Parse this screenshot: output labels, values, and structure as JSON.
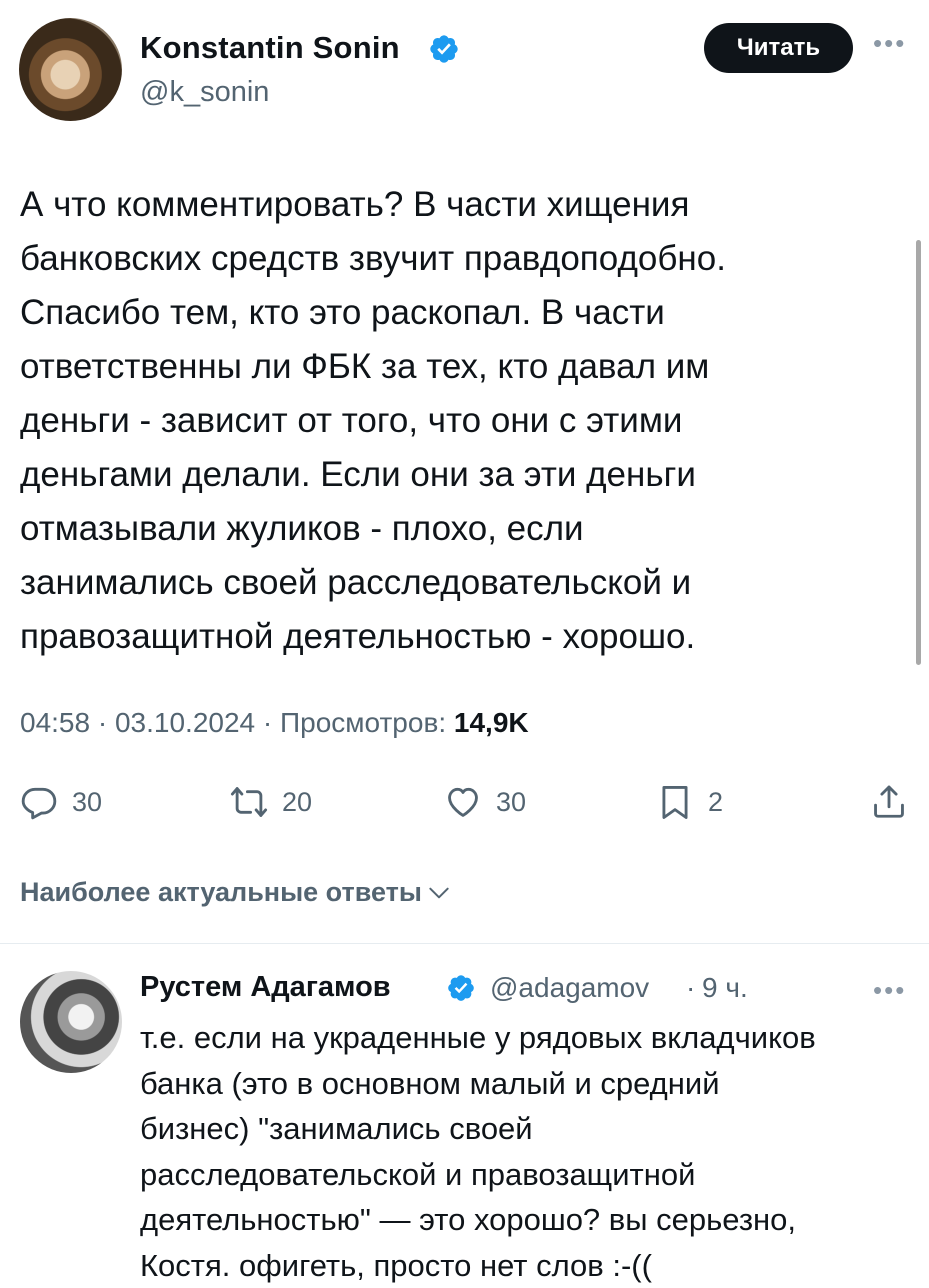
{
  "tweet": {
    "author": {
      "name": "Konstantin Sonin",
      "handle": "@k_sonin",
      "verified": true
    },
    "follow_label": "Читать",
    "more_icon": "more-horizontal-icon",
    "text": "А что комментировать? В части хищения\nбанковских средств звучит правдоподобно.\nСпасибо тем, кто это раскопал. В части\nответственны ли ФБК за тех, кто давал им\nденьги - зависит от того, что они с этими\nденьгами делали. Если они за эти деньги\nотмазывали жуликов - плохо, если\nзанимались своей расследовательской и\nправозащитной деятельностью - хорошо.",
    "time": "04:58",
    "date": "03.10.2024",
    "views_label": "Просмотров:",
    "views_value": "14,9K",
    "sep": "·"
  },
  "actions": {
    "reply": {
      "icon": "reply-icon",
      "count": "30"
    },
    "retweet": {
      "icon": "retweet-icon",
      "count": "20"
    },
    "like": {
      "icon": "heart-icon",
      "count": "30"
    },
    "bookmark": {
      "icon": "bookmark-icon",
      "count": "2"
    },
    "share": {
      "icon": "share-icon"
    }
  },
  "replies_sort": {
    "label": "Наиболее актуальные ответы",
    "icon": "chevron-down-icon"
  },
  "reply": {
    "author": {
      "name": "Рустем Адагамов",
      "handle": "@adagamov",
      "verified": true
    },
    "sep": "·",
    "time": "9 ч.",
    "text": "т.е. если на украденные у рядовых вкладчиков\nбанка (это в основном малый и средний\nбизнес) \"занимались своей\nрасследовательской и правозащитной\nдеятельностью\" — это хорошо? вы серьезно,\nКостя. офигеть, просто нет слов :-(("
  },
  "colors": {
    "text_primary": "#0f1419",
    "text_secondary": "#536471",
    "verified_blue": "#1d9bf0",
    "button_bg": "#0f1419"
  }
}
